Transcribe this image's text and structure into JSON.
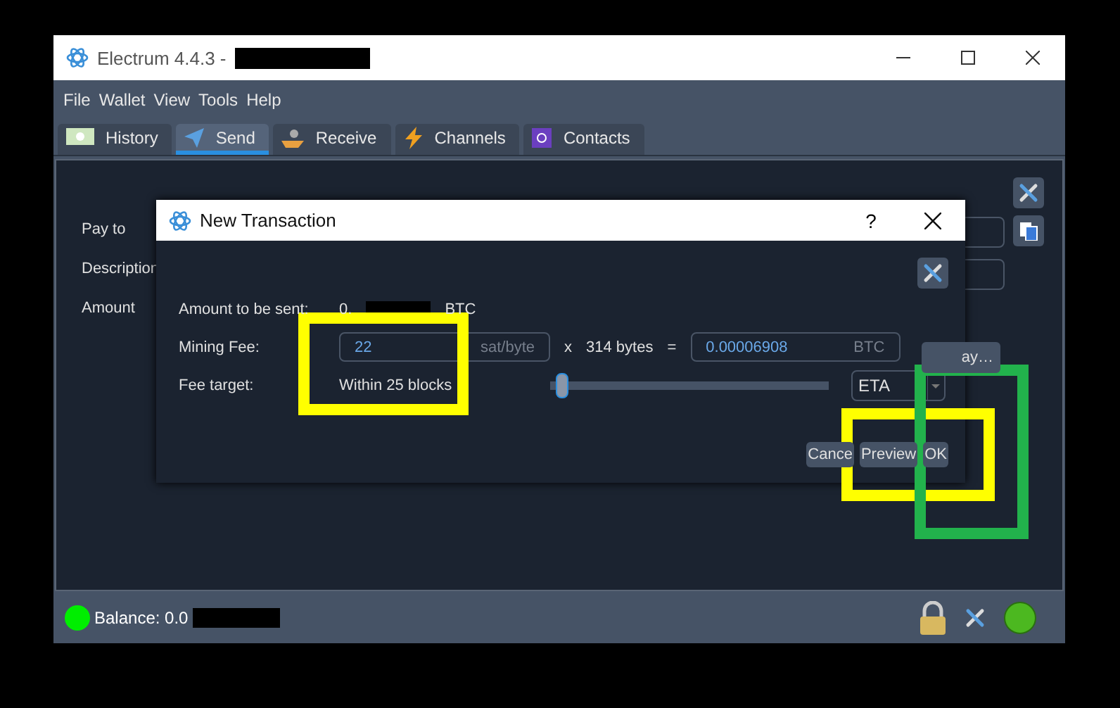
{
  "window": {
    "title": "Electrum 4.4.3  -"
  },
  "menu": [
    "File",
    "Wallet",
    "View",
    "Tools",
    "Help"
  ],
  "tabs": [
    {
      "label": "History",
      "kind": "history",
      "selected": false
    },
    {
      "label": "Send",
      "kind": "send",
      "selected": true
    },
    {
      "label": "Receive",
      "kind": "receive",
      "selected": false
    },
    {
      "label": "Channels",
      "kind": "channels",
      "selected": false
    },
    {
      "label": "Contacts",
      "kind": "contacts",
      "selected": false
    }
  ],
  "send_form": {
    "fields": [
      {
        "label": "Pay to"
      },
      {
        "label": "Description"
      },
      {
        "label": "Amount"
      }
    ],
    "pay_button": "ay…"
  },
  "dialog": {
    "title": "New Transaction",
    "help": "?",
    "amount_label": "Amount to be sent:",
    "amount_value": "0.",
    "amount_unit": "BTC",
    "fee_label": "Mining Fee:",
    "fee_value": "22",
    "fee_unit": "sat/byte",
    "multiply": "x",
    "size": "314 bytes",
    "equals": "=",
    "fee_btc": "0.00006908",
    "fee_btc_unit": "BTC",
    "target_label": "Fee target:",
    "target_value": "Within 25 blocks",
    "slider": {
      "level": 0.02
    },
    "mode": "ETA",
    "buttons": [
      "Cance",
      "Preview",
      "OK"
    ]
  },
  "status_bar": {
    "balance": "Balance: 0.0"
  },
  "highlights": [
    {
      "color": "#ffff00"
    },
    {
      "color": "#ffff00"
    },
    {
      "color": "#22b24c"
    }
  ]
}
